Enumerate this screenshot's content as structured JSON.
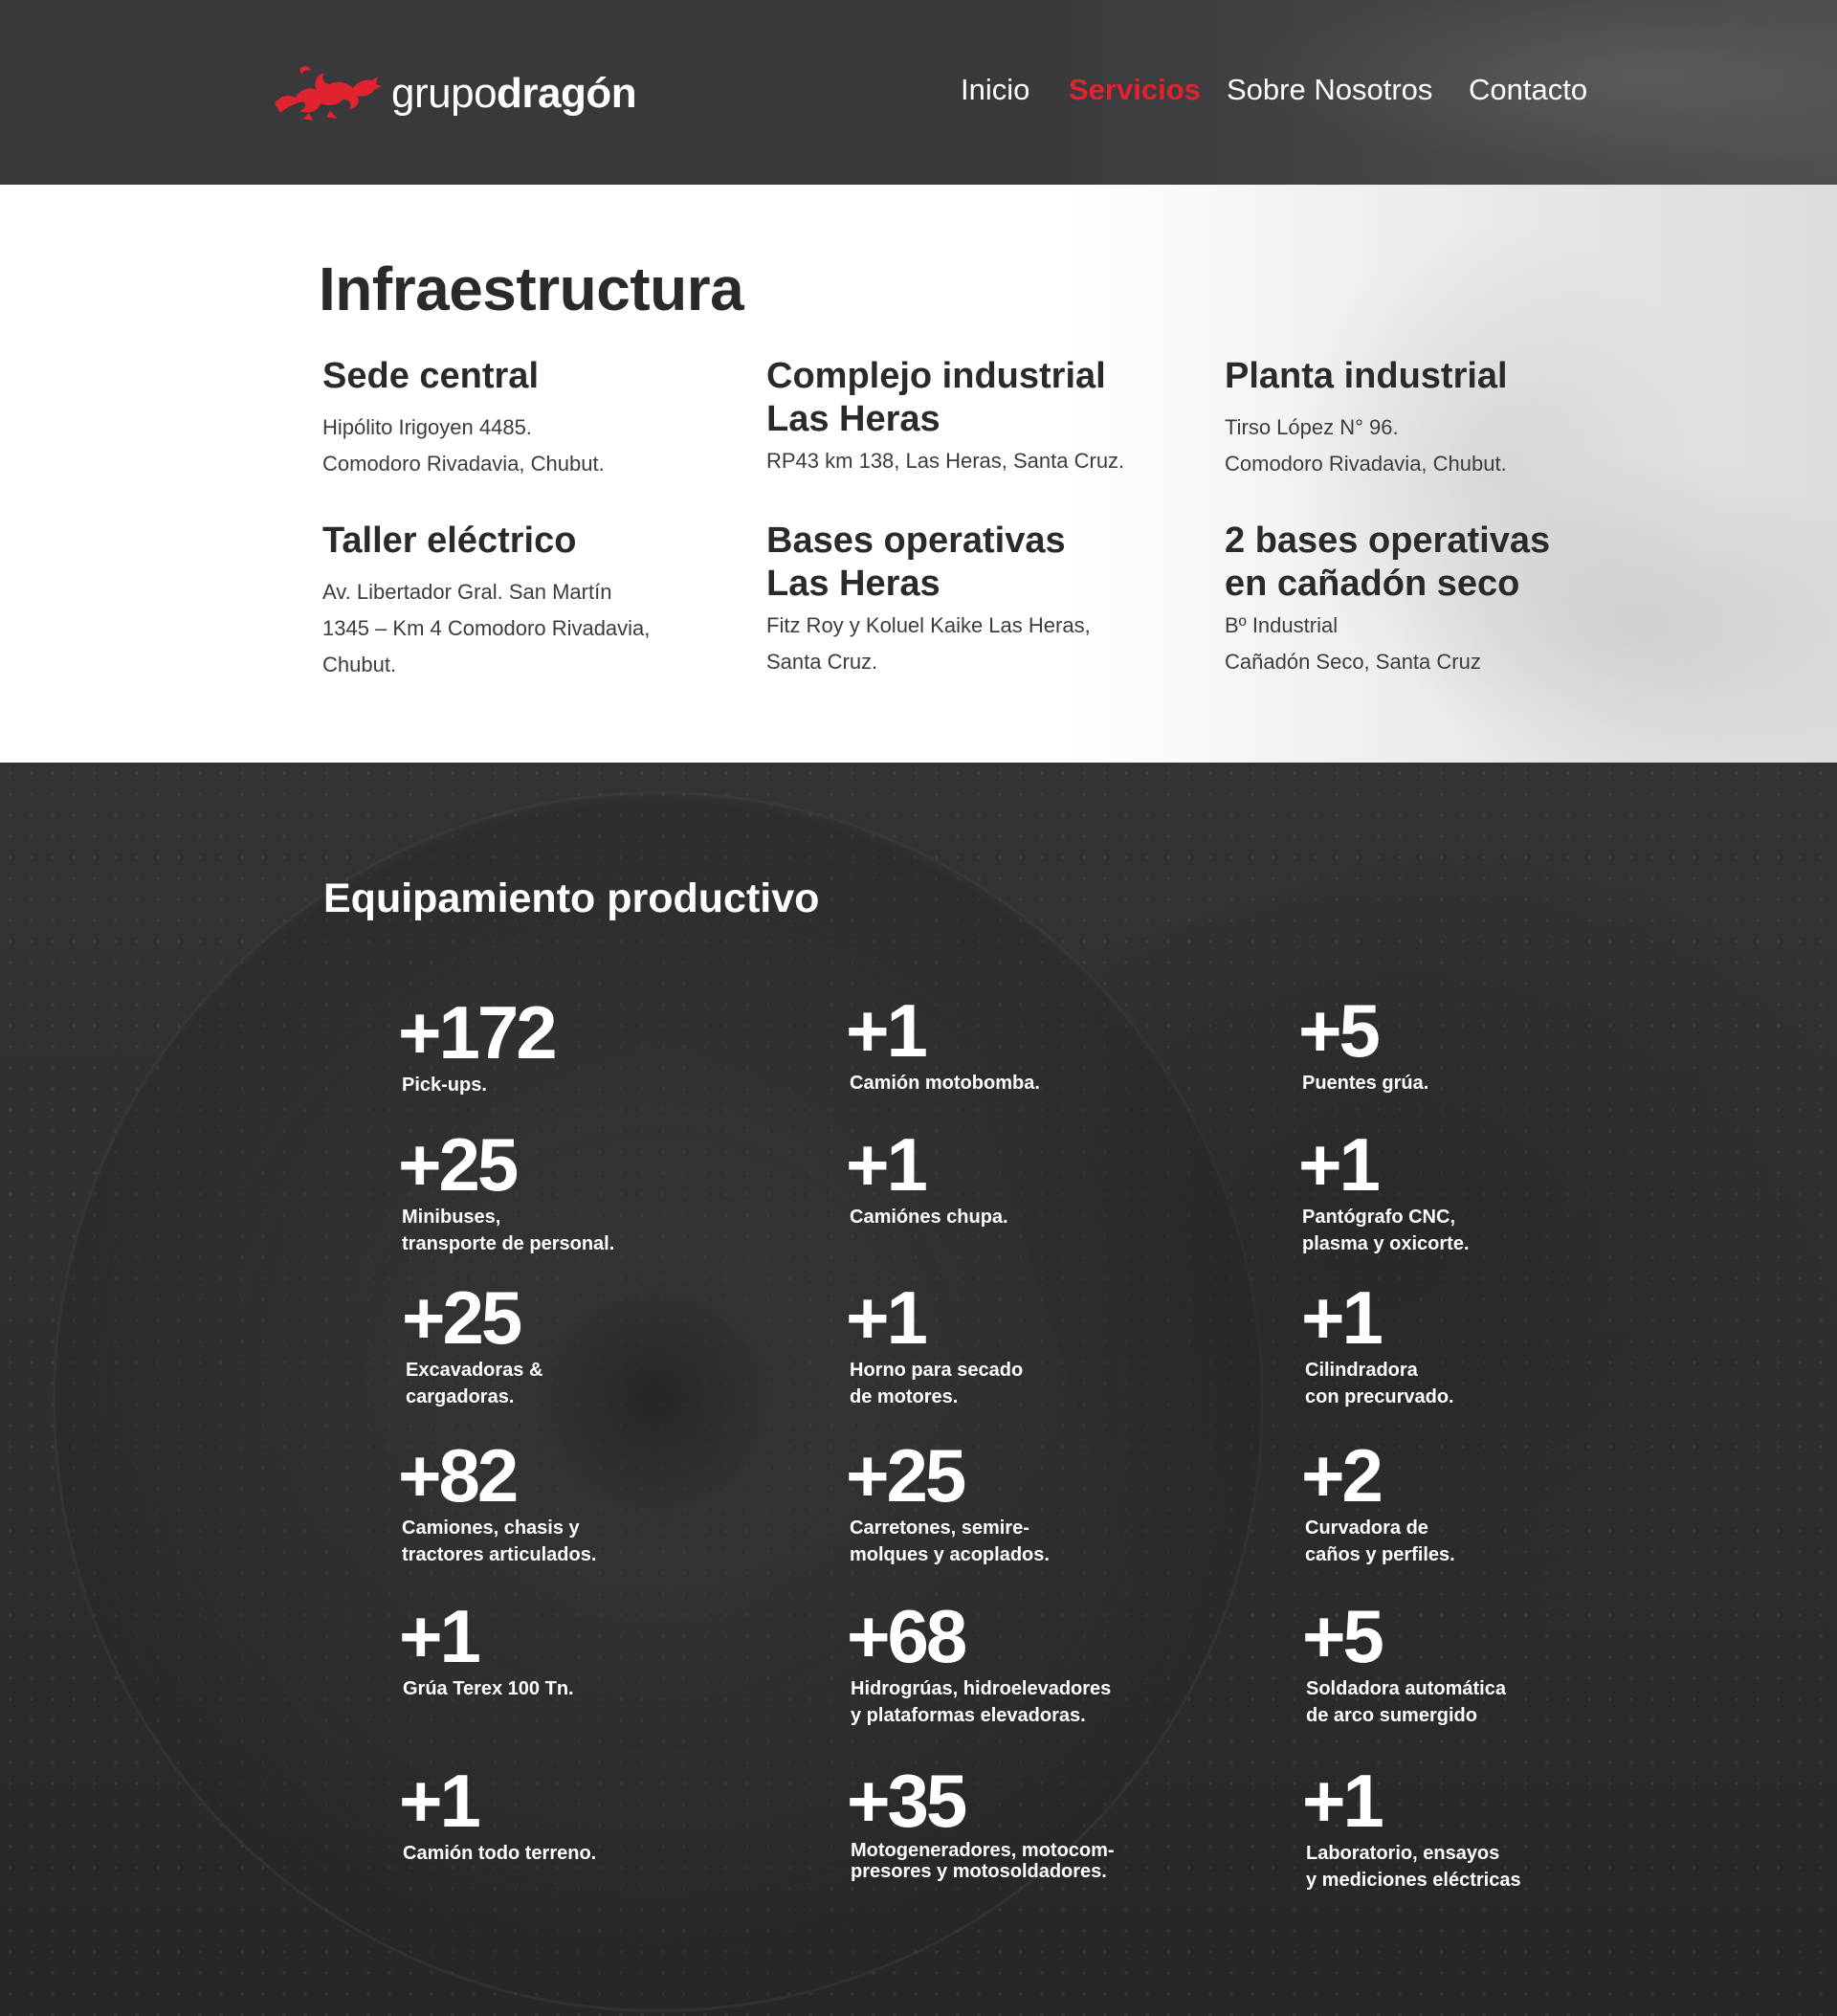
{
  "header": {
    "brand": {
      "light": "grupo",
      "bold": "dragón"
    },
    "nav": [
      {
        "label": "Inicio",
        "active": false
      },
      {
        "label": "Servicios",
        "active": true
      },
      {
        "label": "Sobre Nosotros",
        "active": false
      },
      {
        "label": "Contacto",
        "active": false
      }
    ]
  },
  "infra": {
    "title": "Infraestructura",
    "sites": [
      {
        "title": "Sede central",
        "address": "Hipólito Irigoyen 4485.\nComodoro Rivadavia, Chubut."
      },
      {
        "title": "Complejo industrial\nLas Heras",
        "address": "RP43 km 138, Las Heras, Santa Cruz."
      },
      {
        "title": "Planta industrial",
        "address": "Tirso López N° 96.\nComodoro Rivadavia, Chubut."
      },
      {
        "title": "Taller eléctrico",
        "address": "Av. Libertador Gral. San Martín\n1345 – Km 4 Comodoro Rivadavia,\nChubut."
      },
      {
        "title": "Bases operativas\nLas Heras",
        "address": "Fitz Roy y Koluel Kaike Las Heras,\nSanta Cruz."
      },
      {
        "title": "2 bases operativas\nen cañadón seco",
        "address": "Bº Industrial\nCañadón Seco, Santa Cruz"
      }
    ]
  },
  "equipment": {
    "title": "Equipamiento productivo",
    "stats": [
      {
        "value": "+172",
        "label": "Pick-ups."
      },
      {
        "value": "+1",
        "label": "Camión motobomba."
      },
      {
        "value": "+5",
        "label": "Puentes grúa."
      },
      {
        "value": "+25",
        "label": "Minibuses,\ntransporte de personal."
      },
      {
        "value": "+1",
        "label": "Camiónes chupa."
      },
      {
        "value": "+1",
        "label": "Pantógrafo CNC,\nplasma y oxicorte."
      },
      {
        "value": "+25",
        "label": "Excavadoras &\ncargadoras."
      },
      {
        "value": "+1",
        "label": "Horno para secado\nde motores."
      },
      {
        "value": "+1",
        "label": "Cilindradora\ncon precurvado."
      },
      {
        "value": "+82",
        "label": "Camiones, chasis y\ntractores articulados."
      },
      {
        "value": "+25",
        "label": "Carretones, semire-\nmolques y acoplados."
      },
      {
        "value": "+2",
        "label": "Curvadora de\ncaños y perfiles."
      },
      {
        "value": "+1",
        "label": "Grúa Terex 100 Tn."
      },
      {
        "value": "+68",
        "label": "Hidrogrúas, hidroelevadores\ny plataformas elevadoras."
      },
      {
        "value": "+5",
        "label": "Soldadora automática\nde arco sumergido"
      },
      {
        "value": "+1",
        "label": "Camión todo terreno."
      },
      {
        "value": "+35",
        "label": "Motogeneradores,  motocom-\npresores y motosoldadores."
      },
      {
        "value": "+1",
        "label": "Laboratorio, ensayos\ny mediciones eléctricas"
      }
    ]
  },
  "colors": {
    "accent": "#e0232f",
    "header_bg": "#39393b",
    "dark_bg": "#2f2f31"
  }
}
